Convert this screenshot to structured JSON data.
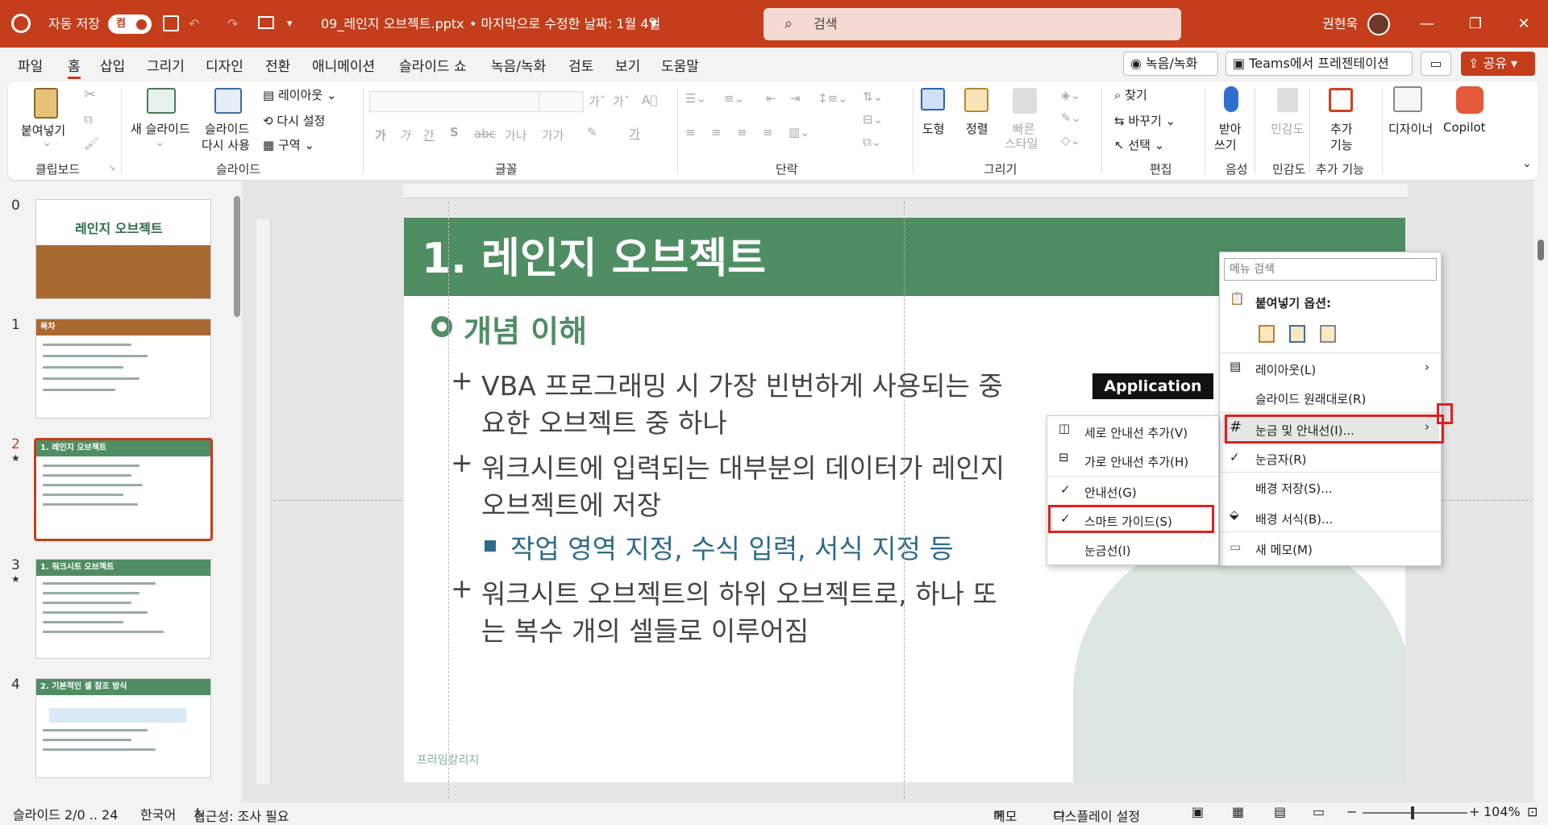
{
  "titlebar": {
    "autosave_label": "자동 저장",
    "autosave_state": "켬",
    "filename": "09_레인지 오브젝트.pptx",
    "modified": "• 마지막으로 수정한 날짜: 1월 4일",
    "search_placeholder": "검색",
    "user": "권현욱"
  },
  "tabs": [
    "파일",
    "홈",
    "삽입",
    "그리기",
    "디자인",
    "전환",
    "애니메이션",
    "슬라이드 쇼",
    "녹음/녹화",
    "검토",
    "보기",
    "도움말"
  ],
  "tab_buttons": {
    "record": "녹음/녹화",
    "teams": "Teams에서 프레젠테이션",
    "share": "공유"
  },
  "ribbon": {
    "paste": "붙여넣기",
    "clipboard": "클립보드",
    "new_slide": "새 슬라이드",
    "reuse1": "슬라이드",
    "reuse2": "다시 사용",
    "layout": "레이아웃",
    "reset": "다시 설정",
    "section": "구역",
    "slides": "슬라이드",
    "font": "글꼴",
    "paragraph": "단락",
    "shape": "도형",
    "arrange": "정렬",
    "quickstyle1": "빠른",
    "quickstyle2": "스타일",
    "drawing": "그리기",
    "find": "찾기",
    "replace": "바꾸기",
    "select": "선택",
    "editing": "편집",
    "dictate1": "받아",
    "dictate2": "쓰기",
    "voice": "음성",
    "sensitivity": "민감도",
    "sensitivity_group": "민감도",
    "addins1": "추가",
    "addins2": "기능",
    "addins_group": "추가 기능",
    "designer": "디자이너",
    "copilot": "Copilot"
  },
  "thumbnails": [
    {
      "num": "0",
      "title": "레인지 오브젝트",
      "star": ""
    },
    {
      "num": "1",
      "title": "목차",
      "star": ""
    },
    {
      "num": "2",
      "title": "1. 레인지 오브젝트",
      "star": "★"
    },
    {
      "num": "3",
      "title": "1. 워크시트 오브젝트",
      "star": "★"
    },
    {
      "num": "4",
      "title": "2. 기본적인 셀 참조 방식",
      "star": ""
    }
  ],
  "slide": {
    "title": "1. 레인지 오브젝트",
    "subtitle": "개념 이해",
    "b1a": "VBA 프로그래밍 시 가장 빈번하게 사용되는 중",
    "b1b": "요한 오브젝트 중 하나",
    "b2a": "워크시트에 입력되는 대부분의 데이터가 레인지",
    "b2b": "오브젝트에 저장",
    "sub": "작업 영역 지정, 수식 입력, 서식 지정 등",
    "b3a": "워크시트 오브젝트의 하위 오브젝트로, 하나 또",
    "b3b": "는 복수 개의 셀들로 이루어짐",
    "app_label": "Application",
    "logo": "프라임칼리지"
  },
  "context_menu": {
    "search_placeholder": "메뉴 검색",
    "paste_options": "붙여넣기 옵션:",
    "layout": "레이아웃(L)",
    "reset": "슬라이드 원래대로(R)",
    "grid": "눈금 및 안내선(I)...",
    "ruler": "눈금자(R)",
    "save_bg": "배경 저장(S)...",
    "format_bg": "배경 서식(B)...",
    "new_comment": "새 메모(M)"
  },
  "submenu": {
    "add_v": "세로 안내선 추가(V)",
    "add_h": "가로 안내선 추가(H)",
    "guides": "안내선(G)",
    "smart": "스마트 가이드(S)",
    "gridlines": "눈금선(I)"
  },
  "status": {
    "slide": "슬라이드 2/0 .. 24",
    "lang": "한국어",
    "access": "접근성: 조사 필요",
    "notes": "메모",
    "display": "디스플레이 설정",
    "zoom": "104%"
  },
  "colors": {
    "accent": "#c43e1c",
    "slide_green": "#4f8d63",
    "highlight": "#e02020"
  }
}
